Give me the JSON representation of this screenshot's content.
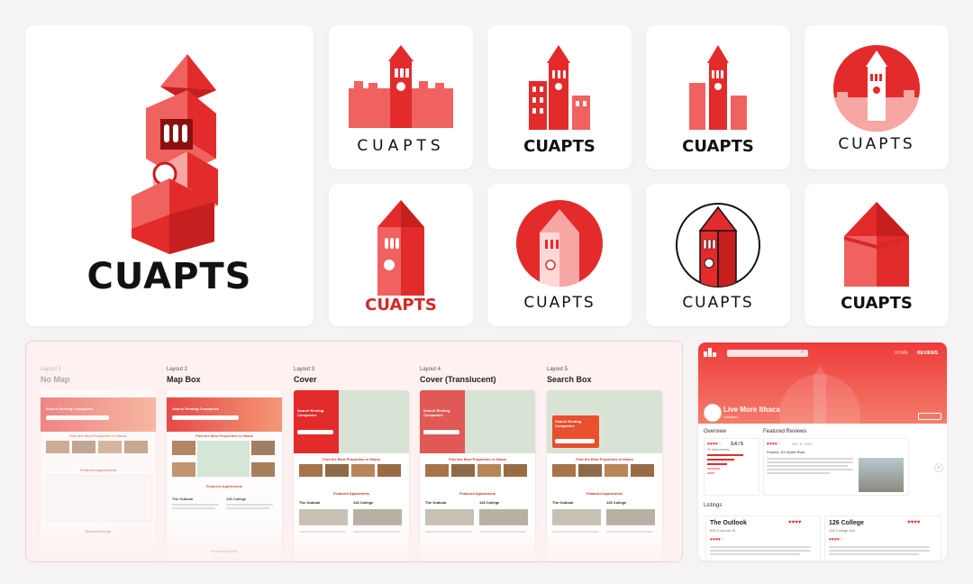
{
  "brand": {
    "name": "CUAPTS",
    "primary_color": "#e32b2b",
    "secondary_color": "#f0625f",
    "light_color": "#f7a6a4"
  },
  "logos": {
    "main": "CUAPTS",
    "v1": "CUAPTS",
    "v2": "CUAPTS",
    "v3": "CUAPTS",
    "v4": "CUAPTS",
    "v5": "CUAPTS",
    "v6": "CUAPTS",
    "v7": "CUAPTS",
    "v8": "CUAPTS"
  },
  "layouts": [
    {
      "label": "Layout 1",
      "title": "No Map"
    },
    {
      "label": "Layout 2",
      "title": "Map Box"
    },
    {
      "label": "Layout 3",
      "title": "Cover"
    },
    {
      "label": "Layout 4",
      "title": "Cover (Translucent)"
    },
    {
      "label": "Layout 5",
      "title": "Search Box"
    }
  ],
  "mock": {
    "hero_title": "Search Renting Companies",
    "find_best": "Find the Best Properties in Ithaca",
    "featured": "Featured Apartments",
    "recent": "Recent Activity",
    "outlook": "The Outlook",
    "college": "126 College",
    "home": "HOME",
    "reviews": "REVIEWS"
  },
  "page_preview": {
    "nav_home": "HOME",
    "nav_reviews": "REVIEWS",
    "company": "Live More Ithaca",
    "company_sub": "Landlord",
    "overview": "Overview",
    "featured_reviews": "Featured Reviews",
    "rating": "3.4 / 5",
    "reviews_count": "29 total reviews",
    "listings": "Listings",
    "listing1_name": "The Outlook",
    "listing1_addr": "835 S Aurora St",
    "listing2_name": "126 College",
    "listing2_addr": "126 College Ave",
    "review_date": "MAY 11, 2019",
    "review_prop": "Property: 111 Dryden Road"
  }
}
